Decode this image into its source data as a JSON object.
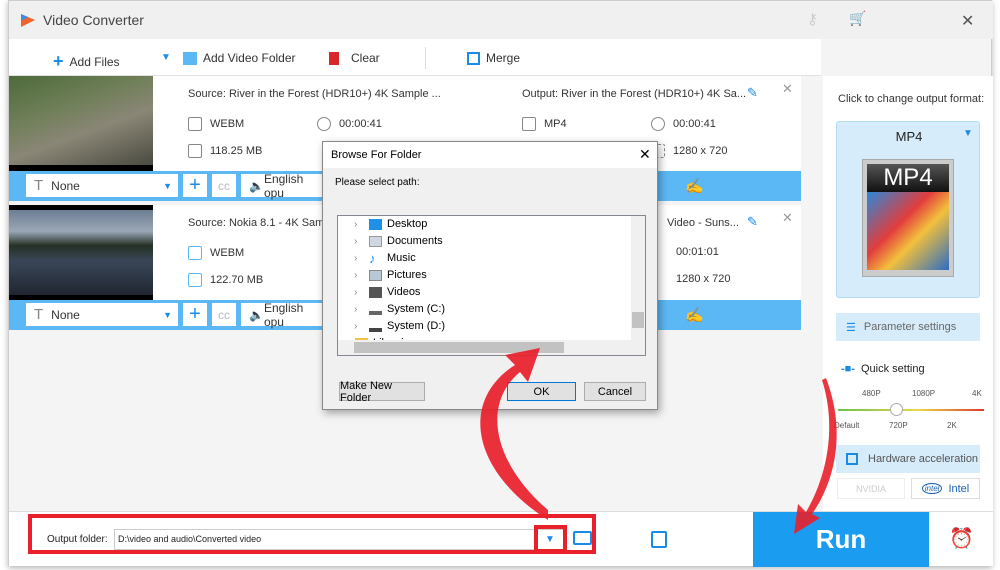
{
  "app": {
    "title": "Video Converter"
  },
  "toolbar": {
    "add_files": "Add Files",
    "add_folder": "Add Video Folder",
    "clear": "Clear",
    "merge": "Merge"
  },
  "items": [
    {
      "source": "Source: River in the Forest (HDR10+) 4K Sample ...",
      "src_format": "WEBM",
      "src_duration": "00:00:41",
      "src_size": "118.25 MB",
      "output": "Output: River in the Forest (HDR10+) 4K Sa...",
      "out_format": "MP4",
      "out_duration": "00:00:41",
      "out_resolution": "1280 x 720",
      "subtitle": "None",
      "audio": "English opu"
    },
    {
      "source": "Source: Nokia 8.1 - 4K Sampl",
      "src_format": "WEBM",
      "src_size": "122.70 MB",
      "output": "Video - Suns...",
      "out_duration": "00:01:01",
      "out_resolution": "1280 x 720",
      "subtitle": "None",
      "audio": "English opu"
    }
  ],
  "right": {
    "hint": "Click to change output format:",
    "format": "MP4",
    "param_settings": "Parameter settings",
    "quick_setting": "Quick setting",
    "quality_top": [
      "480P",
      "1080P",
      "4K"
    ],
    "quality_bottom": [
      "Default",
      "720P",
      "2K"
    ],
    "quality_selected": "720P",
    "hw_accel": "Hardware acceleration",
    "nvidia": "NVIDIA",
    "intel": "Intel"
  },
  "dialog": {
    "title": "Browse For Folder",
    "prompt": "Please select path:",
    "tree": [
      "Desktop",
      "Documents",
      "Music",
      "Pictures",
      "Videos",
      "System (C:)",
      "System (D:)",
      "Libraries"
    ],
    "make_folder": "Make New Folder",
    "ok": "OK",
    "cancel": "Cancel"
  },
  "bottom": {
    "output_label": "Output folder:",
    "output_path": "D:\\video and audio\\Converted video",
    "run": "Run"
  },
  "colors": {
    "accent": "#1a9cf0",
    "bar": "#5bb8f5",
    "highlight": "#e8202a"
  }
}
